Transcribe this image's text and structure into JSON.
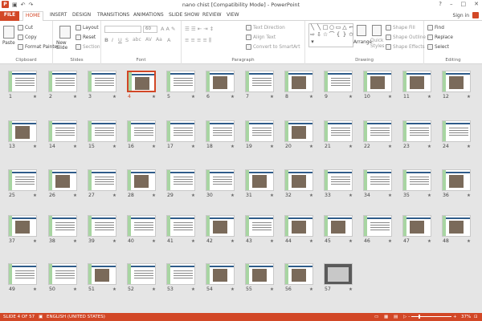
{
  "window": {
    "title": "nano chist [Compatibility Mode] - PowerPoint",
    "sign_in": "Sign in",
    "minimize": "–",
    "maximize": "□",
    "close": "✕",
    "qat_icons": [
      "save-icon",
      "undo-icon",
      "redo-icon"
    ]
  },
  "tabs": [
    "FILE",
    "HOME",
    "INSERT",
    "DESIGN",
    "TRANSITIONS",
    "ANIMATIONS",
    "SLIDE SHOW",
    "REVIEW",
    "VIEW"
  ],
  "ribbon": {
    "clipboard": {
      "paste": "Paste",
      "cut": "Cut",
      "copy": "Copy",
      "format_painter": "Format Painter",
      "label": "Clipboard"
    },
    "slides": {
      "new_slide": "New Slide",
      "layout": "Layout",
      "reset": "Reset",
      "section": "Section",
      "label": "Slides"
    },
    "font": {
      "size": "60",
      "label": "Font"
    },
    "paragraph": {
      "text_direction": "Text Direction",
      "align_text": "Align Text",
      "convert_smartart": "Convert to SmartArt",
      "label": "Paragraph"
    },
    "drawing": {
      "arrange": "Arrange",
      "quick_styles": "Quick Styles",
      "shape_fill": "Shape Fill",
      "shape_outline": "Shape Outline",
      "shape_effects": "Shape Effects",
      "label": "Drawing"
    },
    "editing": {
      "find": "Find",
      "replace": "Replace",
      "select": "Select",
      "label": "Editing"
    }
  },
  "slides": [
    {
      "n": "1",
      "kind": "title"
    },
    {
      "n": "2",
      "kind": "text"
    },
    {
      "n": "3",
      "kind": "text"
    },
    {
      "n": "4",
      "kind": "pic",
      "selected": true
    },
    {
      "n": "5",
      "kind": "text"
    },
    {
      "n": "6",
      "kind": "pic"
    },
    {
      "n": "7",
      "kind": "text"
    },
    {
      "n": "8",
      "kind": "pic"
    },
    {
      "n": "9",
      "kind": "text"
    },
    {
      "n": "10",
      "kind": "pic"
    },
    {
      "n": "11",
      "kind": "pic"
    },
    {
      "n": "12",
      "kind": "pic"
    },
    {
      "n": "13",
      "kind": "pic"
    },
    {
      "n": "14",
      "kind": "text"
    },
    {
      "n": "15",
      "kind": "text"
    },
    {
      "n": "16",
      "kind": "text"
    },
    {
      "n": "17",
      "kind": "text"
    },
    {
      "n": "18",
      "kind": "text"
    },
    {
      "n": "19",
      "kind": "text"
    },
    {
      "n": "20",
      "kind": "pic"
    },
    {
      "n": "21",
      "kind": "text"
    },
    {
      "n": "22",
      "kind": "text"
    },
    {
      "n": "23",
      "kind": "text"
    },
    {
      "n": "24",
      "kind": "text"
    },
    {
      "n": "25",
      "kind": "text"
    },
    {
      "n": "26",
      "kind": "pic"
    },
    {
      "n": "27",
      "kind": "text"
    },
    {
      "n": "28",
      "kind": "pic"
    },
    {
      "n": "29",
      "kind": "text"
    },
    {
      "n": "30",
      "kind": "text"
    },
    {
      "n": "31",
      "kind": "pic"
    },
    {
      "n": "32",
      "kind": "pic"
    },
    {
      "n": "33",
      "kind": "text"
    },
    {
      "n": "34",
      "kind": "text"
    },
    {
      "n": "35",
      "kind": "text"
    },
    {
      "n": "36",
      "kind": "pic"
    },
    {
      "n": "37",
      "kind": "pic"
    },
    {
      "n": "38",
      "kind": "text"
    },
    {
      "n": "39",
      "kind": "text"
    },
    {
      "n": "40",
      "kind": "text"
    },
    {
      "n": "41",
      "kind": "text"
    },
    {
      "n": "42",
      "kind": "pic"
    },
    {
      "n": "43",
      "kind": "text"
    },
    {
      "n": "44",
      "kind": "pic"
    },
    {
      "n": "45",
      "kind": "pic"
    },
    {
      "n": "46",
      "kind": "text"
    },
    {
      "n": "47",
      "kind": "pic"
    },
    {
      "n": "48",
      "kind": "pic"
    },
    {
      "n": "49",
      "kind": "text"
    },
    {
      "n": "50",
      "kind": "text"
    },
    {
      "n": "51",
      "kind": "pic"
    },
    {
      "n": "52",
      "kind": "text"
    },
    {
      "n": "53",
      "kind": "text"
    },
    {
      "n": "54",
      "kind": "pic"
    },
    {
      "n": "55",
      "kind": "pic"
    },
    {
      "n": "56",
      "kind": "pic"
    },
    {
      "n": "57",
      "kind": "photo"
    }
  ],
  "status": {
    "slide_of": "SLIDE 4 OF 57",
    "language": "ENGLISH (UNITED STATES)",
    "zoom": "37%",
    "zoom_minus": "–",
    "zoom_plus": "+"
  },
  "colors": {
    "accent": "#d24726",
    "slide_bar": "#a8d5a2",
    "slide_title": "#2f5c8a"
  }
}
